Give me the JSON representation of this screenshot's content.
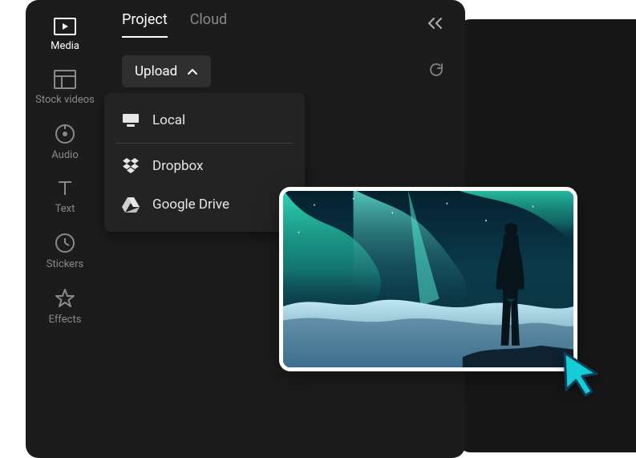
{
  "sidebar": {
    "items": [
      {
        "label": "Media",
        "icon": "media-icon",
        "active": true
      },
      {
        "label": "Stock videos",
        "icon": "layout-icon",
        "active": false
      },
      {
        "label": "Audio",
        "icon": "music-icon",
        "active": false
      },
      {
        "label": "Text",
        "icon": "text-icon",
        "active": false
      },
      {
        "label": "Stickers",
        "icon": "clock-icon",
        "active": false
      },
      {
        "label": "Effects",
        "icon": "star-icon",
        "active": false
      }
    ]
  },
  "tabs": {
    "items": [
      {
        "label": "Project",
        "active": true
      },
      {
        "label": "Cloud",
        "active": false
      }
    ]
  },
  "toolbar": {
    "upload_label": "Upload"
  },
  "upload_menu": {
    "items": [
      {
        "label": "Local",
        "icon": "monitor-icon"
      },
      {
        "label": "Dropbox",
        "icon": "dropbox-icon"
      },
      {
        "label": "Google Drive",
        "icon": "google-drive-icon"
      }
    ]
  },
  "thumbnail": {
    "alt": "aurora-northern-lights-person-silhouette"
  }
}
